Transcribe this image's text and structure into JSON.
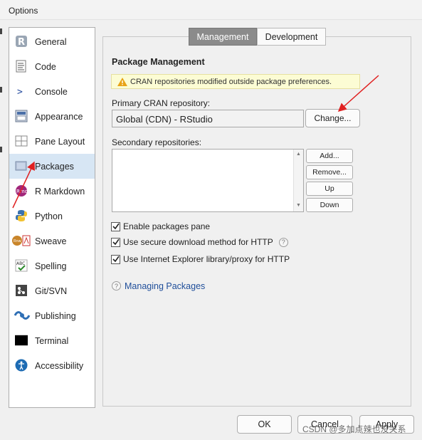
{
  "window": {
    "title": "Options"
  },
  "sidebar": {
    "items": [
      {
        "label": "General",
        "icon": "r-logo-icon"
      },
      {
        "label": "Code",
        "icon": "code-document-icon"
      },
      {
        "label": "Console",
        "icon": "console-prompt-icon"
      },
      {
        "label": "Appearance",
        "icon": "appearance-palette-icon"
      },
      {
        "label": "Pane Layout",
        "icon": "pane-layout-icon"
      },
      {
        "label": "Packages",
        "icon": "packages-box-icon",
        "selected": true
      },
      {
        "label": "R Markdown",
        "icon": "rmarkdown-icon"
      },
      {
        "label": "Python",
        "icon": "python-logo-icon"
      },
      {
        "label": "Sweave",
        "icon": "sweave-pdf-icon"
      },
      {
        "label": "Spelling",
        "icon": "spelling-abc-icon"
      },
      {
        "label": "Git/SVN",
        "icon": "git-icon"
      },
      {
        "label": "Publishing",
        "icon": "publishing-icon"
      },
      {
        "label": "Terminal",
        "icon": "terminal-icon"
      },
      {
        "label": "Accessibility",
        "icon": "accessibility-icon"
      }
    ]
  },
  "tabs": {
    "management": "Management",
    "development": "Development",
    "active": "Management"
  },
  "content": {
    "section_title": "Package Management",
    "warning": "CRAN repositories modified outside package preferences.",
    "primary_label": "Primary CRAN repository:",
    "primary_value": "Global (CDN) - RStudio",
    "change_button": "Change...",
    "secondary_label": "Secondary repositories:",
    "add_button": "Add...",
    "remove_button": "Remove...",
    "up_button": "Up",
    "down_button": "Down",
    "checkboxes": [
      {
        "label": "Enable packages pane",
        "checked": true
      },
      {
        "label": "Use secure download method for HTTP",
        "checked": true
      },
      {
        "label": "Use Internet Explorer library/proxy for HTTP",
        "checked": true
      }
    ],
    "help_link": "Managing Packages"
  },
  "footer": {
    "ok": "OK",
    "cancel": "Cancel",
    "apply": "Apply"
  },
  "watermark": "CSDN @多加点辣也没关系",
  "colors": {
    "selected_bg": "#d7e6f4",
    "active_tab": "#8b8b8b",
    "link": "#1f4e9a",
    "annotation_arrow": "#e02020"
  }
}
